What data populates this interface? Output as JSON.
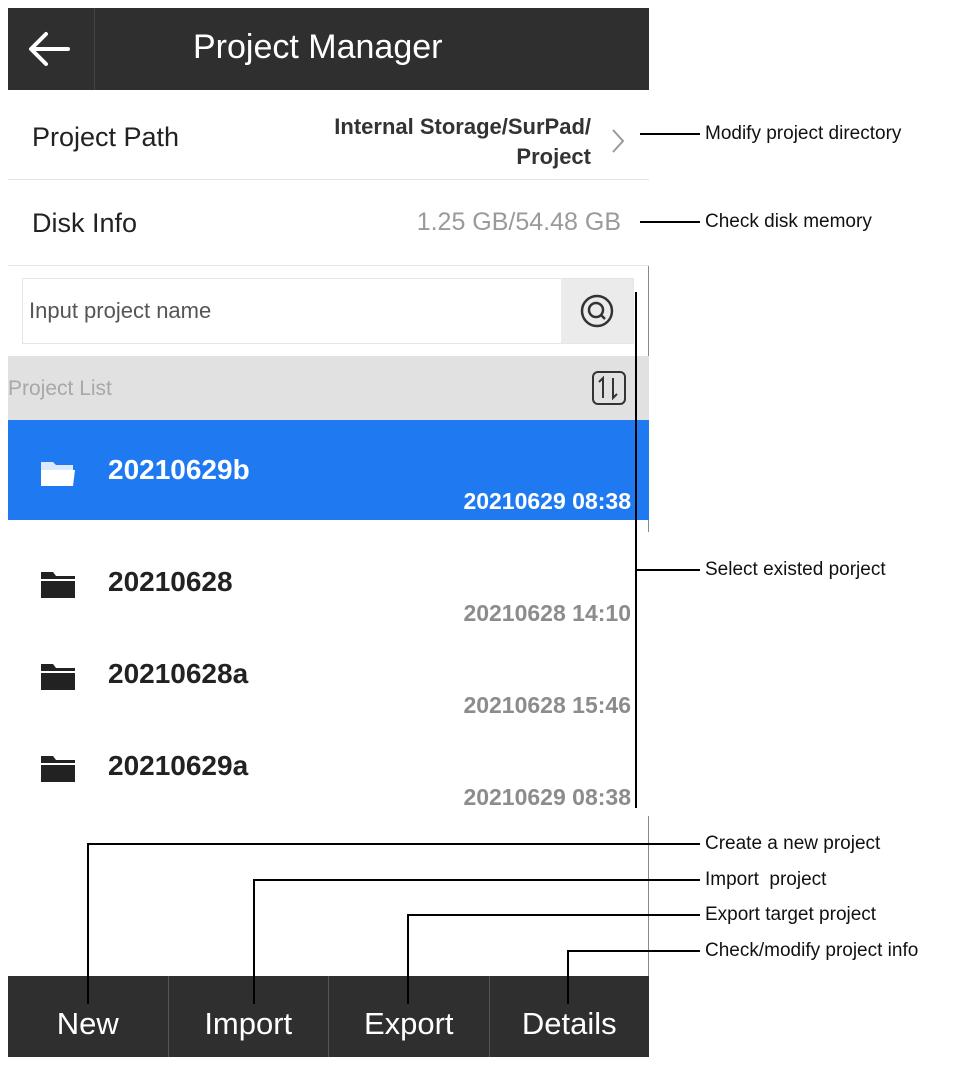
{
  "header": {
    "title": "Project Manager",
    "back_icon": "arrow-left-icon"
  },
  "project_path": {
    "label": "Project Path",
    "value_line1": "Internal Storage/SurPad/",
    "value_line2": "Project"
  },
  "disk_info": {
    "label": "Disk Info",
    "value": "1.25 GB/54.48 GB"
  },
  "search": {
    "placeholder": "Input project name",
    "icon": "search-icon"
  },
  "list": {
    "header_label": "Project List",
    "sort_icon": "sort-icon",
    "items": [
      {
        "name": "20210629b",
        "date": "20210629 08:38",
        "selected": true
      },
      {
        "name": "20210628",
        "date": "20210628 14:10",
        "selected": false
      },
      {
        "name": "20210628a",
        "date": "20210628 15:46",
        "selected": false
      },
      {
        "name": "20210629a",
        "date": "20210629 08:38",
        "selected": false
      }
    ]
  },
  "toolbar": {
    "new": "New",
    "import": "Import",
    "export": "Export",
    "details": "Details"
  },
  "annotations": {
    "modify_directory": "Modify project directory",
    "check_disk": "Check disk memory",
    "select_project": "Select existed porject",
    "create_project": "Create a new project",
    "import_project": "Import  project",
    "export_project": "Export target project",
    "project_info": "Check/modify project info"
  },
  "colors": {
    "topbar": "#2f2f2f",
    "selected": "#1f7af2",
    "list_header": "#e1e1e1"
  }
}
